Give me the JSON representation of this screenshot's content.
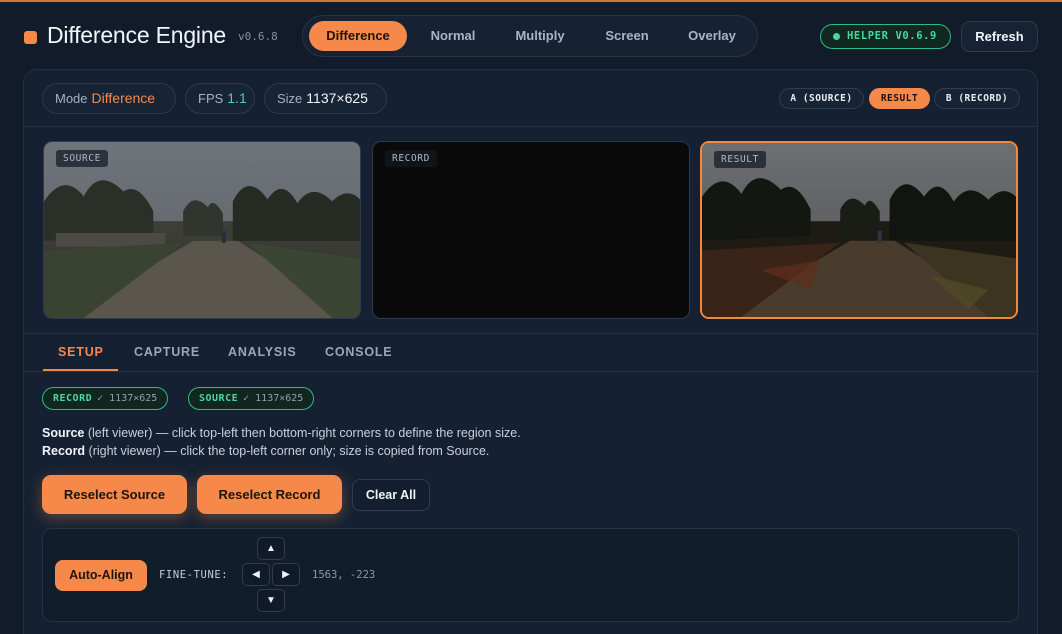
{
  "header": {
    "title": "Difference Engine",
    "version": "v0.6.8",
    "modes": [
      "Difference",
      "Normal",
      "Multiply",
      "Screen",
      "Overlay"
    ],
    "active_mode": "Difference",
    "helper_badge": "HELPER V0.6.9",
    "refresh_label": "Refresh"
  },
  "stats": {
    "mode_label": "Mode",
    "mode_value": "Difference",
    "fps_label": "FPS",
    "fps_value": "1.1",
    "size_label": "Size",
    "size_value": "1137×625"
  },
  "view_toggle": {
    "items": [
      "A (SOURCE)",
      "RESULT",
      "B (RECORD)"
    ],
    "active": "RESULT"
  },
  "viewers": [
    {
      "label": "SOURCE"
    },
    {
      "label": "RECORD"
    },
    {
      "label": "RESULT"
    }
  ],
  "tabs": [
    "SETUP",
    "CAPTURE",
    "ANALYSIS",
    "CONSOLE"
  ],
  "active_tab": "SETUP",
  "setup": {
    "chips": [
      {
        "key": "RECORD",
        "value": "✓ 1137×625"
      },
      {
        "key": "SOURCE",
        "value": "✓ 1137×625"
      }
    ],
    "help": [
      {
        "strong": "Source",
        "text": " (left viewer) — click top-left then bottom-right corners to define the region size."
      },
      {
        "strong": "Record",
        "text": " (right viewer) — click the top-left corner only; size is copied from Source."
      }
    ],
    "buttons": {
      "reselect_source": "Reselect Source",
      "reselect_record": "Reselect Record",
      "clear_all": "Clear All"
    },
    "align": {
      "auto_label": "Auto-Align",
      "fine_label": "FINE-TUNE:",
      "up": "▲",
      "down": "▼",
      "left": "◀",
      "right": "▶",
      "coords": "1563, -223"
    }
  },
  "colors": {
    "accent": "#f6894a",
    "success": "#4ad6a0",
    "background": "#111b2a",
    "panel": "#152132"
  }
}
